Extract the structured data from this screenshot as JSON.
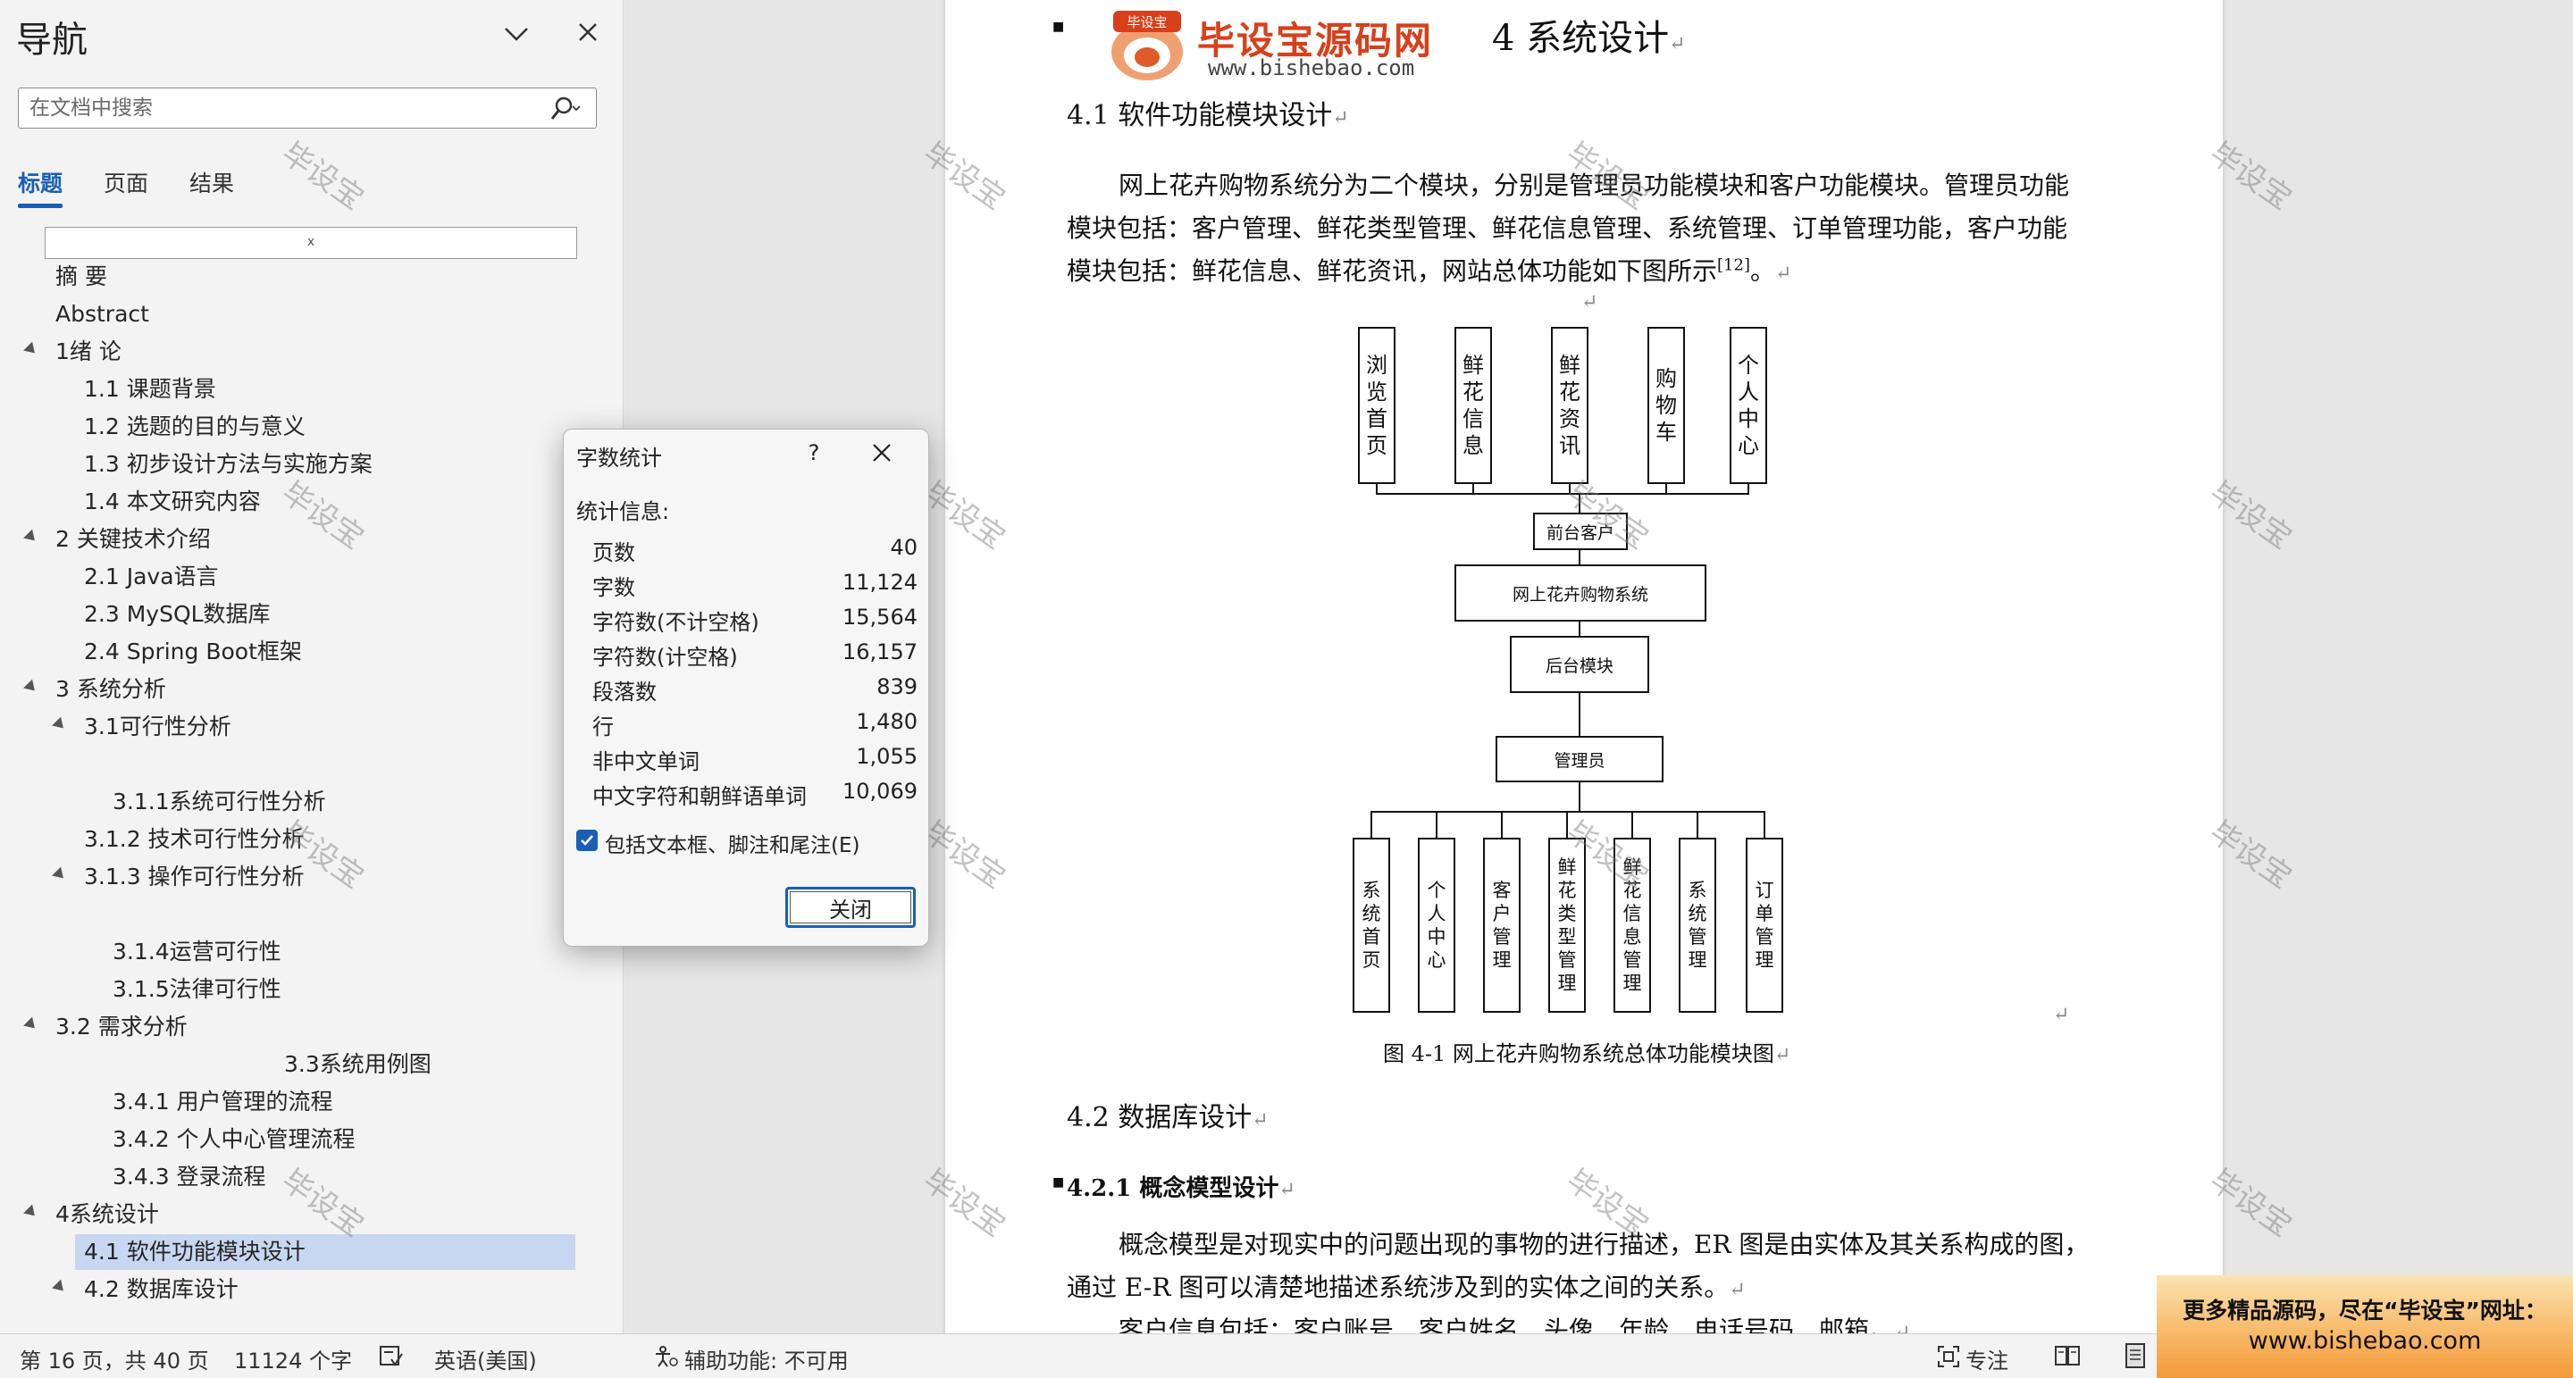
{
  "nav": {
    "title": "导航",
    "search_placeholder": "在文档中搜索",
    "tabs": [
      "标题",
      "页面",
      "结果"
    ],
    "heading_box_mark": "ⅹ",
    "items": [
      {
        "label": "摘  要"
      },
      {
        "label": "Abstract"
      },
      {
        "label": "1绪 论"
      },
      {
        "label": "1.1 课题背景"
      },
      {
        "label": "1.2 选题的目的与意义"
      },
      {
        "label": "1.3 初步设计方法与实施方案"
      },
      {
        "label": "1.4 本文研究内容"
      },
      {
        "label": "2 关键技术介绍"
      },
      {
        "label": "2.1 Java语言"
      },
      {
        "label": "2.3 MySQL数据库"
      },
      {
        "label": "2.4 Spring Boot框架"
      },
      {
        "label": "3 系统分析"
      },
      {
        "label": "3.1可行性分析"
      },
      {
        "label": "3.1.1系统可行性分析"
      },
      {
        "label": "3.1.2 技术可行性分析"
      },
      {
        "label": "3.1.3 操作可行性分析"
      },
      {
        "label": "3.1.4运营可行性"
      },
      {
        "label": "3.1.5法律可行性"
      },
      {
        "label": "3.2 需求分析"
      },
      {
        "label": "3.3系统用例图"
      },
      {
        "label": "3.4.1 用户管理的流程"
      },
      {
        "label": "3.4.2 个人中心管理流程"
      },
      {
        "label": "3.4.3 登录流程"
      },
      {
        "label": "4系统设计"
      },
      {
        "label": "4.1 软件功能模块设计"
      },
      {
        "label": "4.2 数据库设计"
      }
    ]
  },
  "document": {
    "logo_text": "毕设宝源码网",
    "logo_badge": "毕设宝",
    "logo_url": "www.bishebao.com",
    "chapter_title": "4 系统设计",
    "section_41": "4.1  软件功能模块设计",
    "para1_line1": "网上花卉购物系统分为二个模块，分别是管理员功能模块和客户功能模块。管理员功能",
    "para1_line2": "模块包括：客户管理、鲜花类型管理、鲜花信息管理、系统管理、订单管理功能，客户功能",
    "para1_line3": "模块包括：鲜花信息、鲜花资讯，网站总体功能如下图所示",
    "para1_cite": "[12]",
    "para1_end": "。",
    "top_modules": [
      "浏览首页",
      "鲜花信息",
      "鲜花资讯",
      "购物车",
      "个人中心"
    ],
    "front_label": "前台客户",
    "system_label": "网上花卉购物系统",
    "backend_label": "后台模块",
    "admin_label": "管理员",
    "bottom_modules": [
      "系统首页",
      "个人中心",
      "客户管理",
      "鲜花类型管理",
      "鲜花信息管理",
      "系统管理",
      "订单管理"
    ],
    "figure_caption": "图 4-1 网上花卉购物系统总体功能模块图",
    "section_42": "4.2  数据库设计",
    "section_421": "4.2.1  概念模型设计",
    "para2_line1": "概念模型是对现实中的问题出现的事物的进行描述，ER 图是由实体及其关系构成的图，",
    "para2_line2": "通过 E-R 图可以清楚地描述系统涉及到的实体之间的关系。",
    "para3_line1": "客户信息包括：客户账号、客户姓名、头像、年龄、电话号码、邮箱。",
    "return_mark": "↵",
    "watermark": "毕设宝"
  },
  "dialog": {
    "title": "字数统计",
    "help": "?",
    "info_label": "统计信息:",
    "stats": [
      {
        "label": "页数",
        "value": "40"
      },
      {
        "label": "字数",
        "value": "11,124"
      },
      {
        "label": "字符数(不计空格)",
        "value": "15,564"
      },
      {
        "label": "字符数(计空格)",
        "value": "16,157"
      },
      {
        "label": "段落数",
        "value": "839"
      },
      {
        "label": "行",
        "value": "1,480"
      },
      {
        "label": "非中文单词",
        "value": "1,055"
      },
      {
        "label": "中文字符和朝鲜语单词",
        "value": "10,069"
      }
    ],
    "checkbox_label": "包括文本框、脚注和尾注(E)",
    "checkbox_checked": true,
    "close_button": "关闭"
  },
  "statusbar": {
    "page_info": "第 16 页，共 40 页",
    "word_count": "11124 个字",
    "language": "英语(美国)",
    "accessibility": "辅助功能: 不可用",
    "focus": "专注"
  },
  "promo": {
    "line1": "更多精品源码，尽在“毕设宝”网址：",
    "line2": "www.bishebao.com"
  },
  "colors": {
    "accent": "#1a5fb4",
    "selected_bg": "#c8d7f1",
    "logo": "#d8401b"
  }
}
